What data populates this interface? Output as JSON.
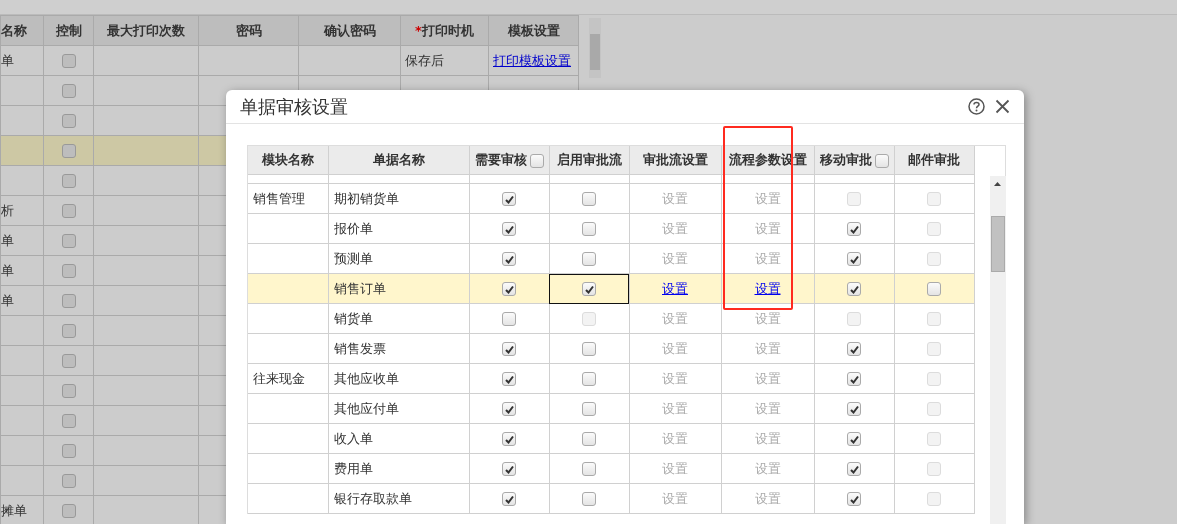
{
  "background_table": {
    "columns": [
      {
        "label": "名称"
      },
      {
        "label": "控制"
      },
      {
        "label": "最大打印次数"
      },
      {
        "label": "密码"
      },
      {
        "label": "确认密码"
      },
      {
        "label": "打印时机",
        "mark": "*"
      },
      {
        "label": "模板设置"
      }
    ],
    "rows": [
      {
        "name": "单",
        "checked": false,
        "selected": false,
        "print_timing": "保存后",
        "template": "打印模板设置"
      },
      {
        "checked": false,
        "selected": false
      },
      {
        "checked": false,
        "selected": false
      },
      {
        "checked": false,
        "selected": true
      },
      {
        "checked": false,
        "selected": false
      },
      {
        "name": "析",
        "checked": false,
        "selected": false
      },
      {
        "name": "单",
        "checked": false,
        "selected": false
      },
      {
        "name": "单",
        "checked": false,
        "selected": false
      },
      {
        "name": "单",
        "checked": false,
        "selected": false
      },
      {
        "checked": false,
        "selected": false
      },
      {
        "checked": false,
        "selected": false
      },
      {
        "checked": false,
        "selected": false
      },
      {
        "checked": false,
        "selected": false
      },
      {
        "checked": false,
        "selected": false
      },
      {
        "checked": false,
        "selected": false
      },
      {
        "name": "摊单",
        "checked": false,
        "selected": false
      }
    ]
  },
  "dialog": {
    "title": "单据审核设置",
    "columns": [
      {
        "label": "模块名称",
        "highlighted": false
      },
      {
        "label": "单据名称",
        "highlighted": false
      },
      {
        "label": "需要审核",
        "highlighted": false,
        "checkbox": {
          "checked": false
        }
      },
      {
        "label": "启用审批流",
        "highlighted": false
      },
      {
        "label": "审批流设置",
        "highlighted": false
      },
      {
        "label": "流程参数设置",
        "highlighted": true
      },
      {
        "label": "移动审批",
        "highlighted": false,
        "checkbox": {
          "checked": false
        }
      },
      {
        "label": "邮件审批",
        "highlighted": false
      }
    ],
    "rows": [
      {
        "module": "销售管理",
        "name": "期初销货单",
        "selected": false,
        "need_audit": {
          "checked": true,
          "disabled": false
        },
        "enable_flow": {
          "checked": false,
          "disabled": false
        },
        "flow_setting": {
          "label": "设置",
          "active": false
        },
        "param_setting": {
          "label": "设置",
          "active": false
        },
        "mobile": {
          "checked": false,
          "disabled": true
        },
        "email": {
          "checked": false,
          "disabled": true
        }
      },
      {
        "name": "报价单",
        "selected": false,
        "need_audit": {
          "checked": true,
          "disabled": false
        },
        "enable_flow": {
          "checked": false,
          "disabled": false
        },
        "flow_setting": {
          "label": "设置",
          "active": false
        },
        "param_setting": {
          "label": "设置",
          "active": false
        },
        "mobile": {
          "checked": true,
          "disabled": false
        },
        "email": {
          "checked": false,
          "disabled": true
        }
      },
      {
        "name": "预测单",
        "selected": false,
        "need_audit": {
          "checked": true,
          "disabled": false
        },
        "enable_flow": {
          "checked": false,
          "disabled": false
        },
        "flow_setting": {
          "label": "设置",
          "active": false
        },
        "param_setting": {
          "label": "设置",
          "active": false
        },
        "mobile": {
          "checked": true,
          "disabled": false
        },
        "email": {
          "checked": false,
          "disabled": true
        }
      },
      {
        "name": "销售订单",
        "selected": true,
        "need_audit": {
          "checked": true,
          "disabled": false
        },
        "enable_flow": {
          "checked": true,
          "disabled": false
        },
        "flow_setting": {
          "label": "设置",
          "active": true
        },
        "param_setting": {
          "label": "设置",
          "active": true
        },
        "mobile": {
          "checked": true,
          "disabled": false
        },
        "email": {
          "checked": false,
          "disabled": false
        }
      },
      {
        "name": "销货单",
        "selected": false,
        "need_audit": {
          "checked": false,
          "disabled": false
        },
        "enable_flow": {
          "checked": false,
          "disabled": true
        },
        "flow_setting": {
          "label": "设置",
          "active": false
        },
        "param_setting": {
          "label": "设置",
          "active": false
        },
        "mobile": {
          "checked": false,
          "disabled": true
        },
        "email": {
          "checked": false,
          "disabled": true
        }
      },
      {
        "name": "销售发票",
        "selected": false,
        "need_audit": {
          "checked": true,
          "disabled": false
        },
        "enable_flow": {
          "checked": false,
          "disabled": false
        },
        "flow_setting": {
          "label": "设置",
          "active": false
        },
        "param_setting": {
          "label": "设置",
          "active": false
        },
        "mobile": {
          "checked": true,
          "disabled": false
        },
        "email": {
          "checked": false,
          "disabled": true
        }
      },
      {
        "module": "往来现金",
        "name": "其他应收单",
        "selected": false,
        "need_audit": {
          "checked": true,
          "disabled": false
        },
        "enable_flow": {
          "checked": false,
          "disabled": false
        },
        "flow_setting": {
          "label": "设置",
          "active": false
        },
        "param_setting": {
          "label": "设置",
          "active": false
        },
        "mobile": {
          "checked": true,
          "disabled": false
        },
        "email": {
          "checked": false,
          "disabled": true
        }
      },
      {
        "name": "其他应付单",
        "selected": false,
        "need_audit": {
          "checked": true,
          "disabled": false
        },
        "enable_flow": {
          "checked": false,
          "disabled": false
        },
        "flow_setting": {
          "label": "设置",
          "active": false
        },
        "param_setting": {
          "label": "设置",
          "active": false
        },
        "mobile": {
          "checked": true,
          "disabled": false
        },
        "email": {
          "checked": false,
          "disabled": true
        }
      },
      {
        "name": "收入单",
        "selected": false,
        "need_audit": {
          "checked": true,
          "disabled": false
        },
        "enable_flow": {
          "checked": false,
          "disabled": false
        },
        "flow_setting": {
          "label": "设置",
          "active": false
        },
        "param_setting": {
          "label": "设置",
          "active": false
        },
        "mobile": {
          "checked": true,
          "disabled": false
        },
        "email": {
          "checked": false,
          "disabled": true
        }
      },
      {
        "name": "费用单",
        "selected": false,
        "need_audit": {
          "checked": true,
          "disabled": false
        },
        "enable_flow": {
          "checked": false,
          "disabled": false
        },
        "flow_setting": {
          "label": "设置",
          "active": false
        },
        "param_setting": {
          "label": "设置",
          "active": false
        },
        "mobile": {
          "checked": true,
          "disabled": false
        },
        "email": {
          "checked": false,
          "disabled": true
        }
      },
      {
        "name": "银行存取款单",
        "selected": false,
        "need_audit": {
          "checked": true,
          "disabled": false
        },
        "enable_flow": {
          "checked": false,
          "disabled": false
        },
        "flow_setting": {
          "label": "设置",
          "active": false
        },
        "param_setting": {
          "label": "设置",
          "active": false
        },
        "mobile": {
          "checked": true,
          "disabled": false
        },
        "email": {
          "checked": false,
          "disabled": true
        }
      }
    ]
  }
}
